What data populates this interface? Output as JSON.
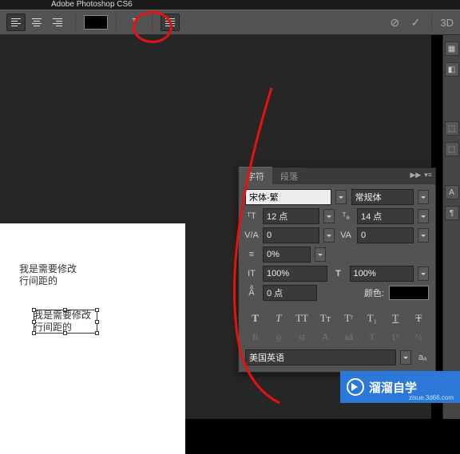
{
  "app": {
    "title": "Adobe Photoshop CS6"
  },
  "optbar": {
    "threeD": "3D"
  },
  "canvas": {
    "text1_line1": "我是需要修改",
    "text1_line2": "行间距的",
    "text2_line1": "我是需要修改",
    "text2_line2": "行间距的"
  },
  "panel": {
    "tab_char": "字符",
    "tab_para": "段落",
    "font_family": "宋体-繁",
    "font_style": "常规体",
    "font_size": "12 点",
    "leading": "14 点",
    "va_tracking": "0",
    "va_kerning": "0",
    "scale": "0%",
    "vscale": "100%",
    "hscale": "100%",
    "baseline": "0 点",
    "color_label": "颜色:",
    "styles": {
      "bold": "T",
      "italic": "T",
      "allcaps": "TT",
      "smallcaps": "Tᴛ",
      "superscript": "Tʳ",
      "subscript": "T₁",
      "underline": "T",
      "strike": "T"
    },
    "ot": {
      "fi": "fi",
      "oe": "o̲",
      "st": "st",
      "A": "A",
      "aa": "aá",
      "Tst": "T",
      "first": "1ˢᵗ",
      "half": "½"
    },
    "language": "美国英语"
  },
  "logo": {
    "name": "溜溜自学",
    "url": "zixue.3d66.com"
  }
}
